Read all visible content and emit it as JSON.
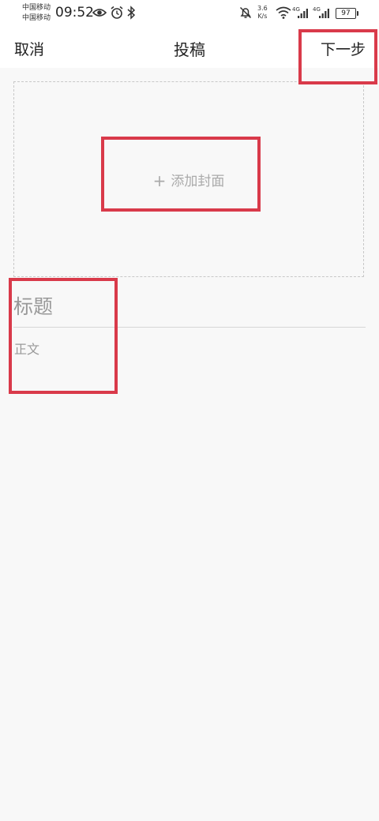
{
  "status_bar": {
    "carrier_1": "中国移动",
    "carrier_2": "中国移动",
    "time": "09:52",
    "speed_value": "3.6",
    "speed_unit": "K/s",
    "network_1": "4G",
    "network_2": "4G",
    "battery": "97",
    "icons": [
      "eye-icon",
      "alarm-icon",
      "bluetooth-icon",
      "mute-bell-icon",
      "wifi-icon",
      "signal-icon",
      "battery-icon"
    ]
  },
  "nav": {
    "cancel_label": "取消",
    "title": "投稿",
    "next_label": "下一步"
  },
  "editor": {
    "add_cover_plus": "+",
    "add_cover_label": "添加封面",
    "title_placeholder": "标题",
    "body_placeholder": "正文"
  },
  "colors": {
    "background": "#f8f8f8",
    "highlight": "#d93a4a",
    "placeholder": "#999999"
  }
}
